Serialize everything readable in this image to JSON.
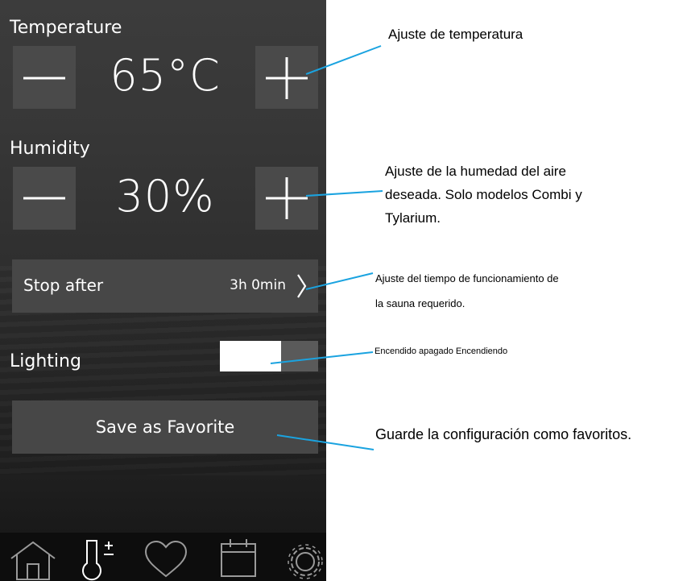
{
  "temperature": {
    "label": "Temperature",
    "value": "65°C",
    "minus_icon": "minus-icon",
    "plus_icon": "plus-icon"
  },
  "humidity": {
    "label": "Humidity",
    "value": "30%",
    "minus_icon": "minus-icon",
    "plus_icon": "plus-icon"
  },
  "stop_after": {
    "label": "Stop after",
    "value": "3h 0min",
    "icon": "chevron-right-icon"
  },
  "lighting": {
    "label": "Lighting",
    "state": "off"
  },
  "favorite": {
    "label": "Save as Favorite"
  },
  "nav": {
    "items": [
      "home-icon",
      "thermometer-plus-icon",
      "heart-icon",
      "calendar-icon",
      "settings-gear-icon"
    ]
  },
  "callouts": {
    "temperature": "Ajuste de temperatura",
    "humidity_line1": "Ajuste de la humedad del aire",
    "humidity_line2": "deseada. Solo modelos Combi y",
    "humidity_line3": "Tylarium.",
    "stop_line1": "Ajuste del tiempo de funcionamiento de",
    "stop_line2": "la sauna requerido.",
    "lighting": "Encendido apagado Encendiendo",
    "favorite": "Guarde la configuración como favoritos."
  },
  "colors": {
    "panel": "#333333",
    "button": "#4a4a4a",
    "callout_line": "#1aa3e0",
    "text": "#ffffff"
  }
}
